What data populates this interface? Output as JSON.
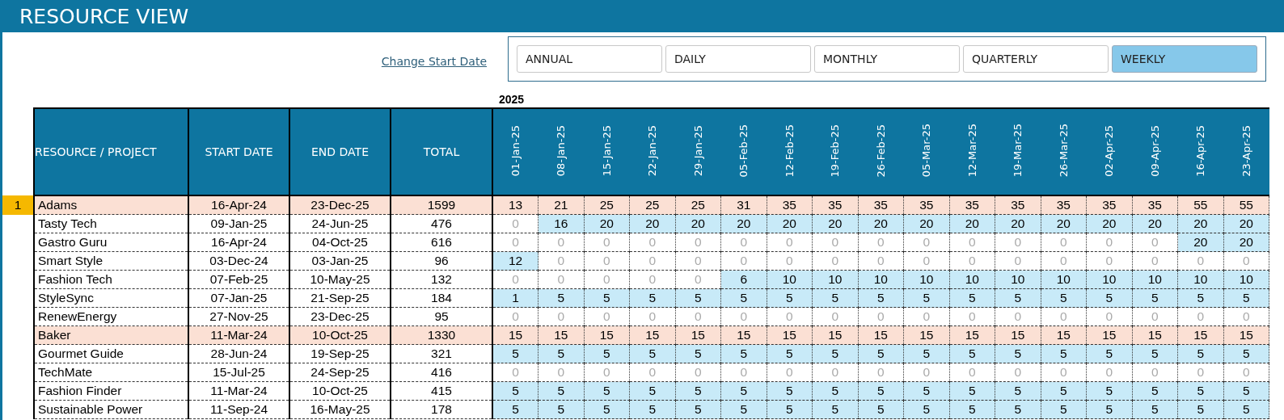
{
  "title": "RESOURCE VIEW",
  "change_start_date": "Change Start Date",
  "periods": [
    {
      "label": "ANNUAL",
      "selected": false
    },
    {
      "label": "DAILY",
      "selected": false
    },
    {
      "label": "MONTHLY",
      "selected": false
    },
    {
      "label": "QUARTERLY",
      "selected": false
    },
    {
      "label": "WEEKLY",
      "selected": true
    }
  ],
  "year": "2025",
  "table": {
    "columns": [
      "RESOURCE / PROJECT",
      "START DATE",
      "END DATE",
      "TOTAL"
    ],
    "weeks": [
      "01-Jan-25",
      "08-Jan-25",
      "15-Jan-25",
      "22-Jan-25",
      "29-Jan-25",
      "05-Feb-25",
      "12-Feb-25",
      "19-Feb-25",
      "26-Feb-25",
      "05-Mar-25",
      "12-Mar-25",
      "19-Mar-25",
      "26-Mar-25",
      "02-Apr-25",
      "09-Apr-25",
      "16-Apr-25",
      "23-Apr-25"
    ],
    "rows": [
      {
        "kind": "resource",
        "row_number": "1",
        "name": "Adams",
        "start": "16-Apr-24",
        "end": "23-Dec-25",
        "total": "1599",
        "values": [
          "13",
          "21",
          "25",
          "25",
          "25",
          "31",
          "35",
          "35",
          "35",
          "35",
          "35",
          "35",
          "35",
          "35",
          "35",
          "55",
          "55"
        ]
      },
      {
        "kind": "project",
        "name": "Tasty Tech",
        "start": "09-Jan-25",
        "end": "24-Jun-25",
        "total": "476",
        "cells": [
          {
            "value": "0",
            "active": false
          },
          {
            "value": "16",
            "active": true
          },
          {
            "value": "20",
            "active": true
          },
          {
            "value": "20",
            "active": true
          },
          {
            "value": "20",
            "active": true
          },
          {
            "value": "20",
            "active": true
          },
          {
            "value": "20",
            "active": true
          },
          {
            "value": "20",
            "active": true
          },
          {
            "value": "20",
            "active": true
          },
          {
            "value": "20",
            "active": true
          },
          {
            "value": "20",
            "active": true
          },
          {
            "value": "20",
            "active": true
          },
          {
            "value": "20",
            "active": true
          },
          {
            "value": "20",
            "active": true
          },
          {
            "value": "20",
            "active": true
          },
          {
            "value": "20",
            "active": true
          },
          {
            "value": "20",
            "active": true
          }
        ]
      },
      {
        "kind": "project",
        "name": "Gastro Guru",
        "start": "16-Apr-24",
        "end": "04-Oct-25",
        "total": "616",
        "cells": [
          {
            "value": "0",
            "active": false
          },
          {
            "value": "0",
            "active": false
          },
          {
            "value": "0",
            "active": false
          },
          {
            "value": "0",
            "active": false
          },
          {
            "value": "0",
            "active": false
          },
          {
            "value": "0",
            "active": false
          },
          {
            "value": "0",
            "active": false
          },
          {
            "value": "0",
            "active": false
          },
          {
            "value": "0",
            "active": false
          },
          {
            "value": "0",
            "active": false
          },
          {
            "value": "0",
            "active": false
          },
          {
            "value": "0",
            "active": false
          },
          {
            "value": "0",
            "active": false
          },
          {
            "value": "0",
            "active": false
          },
          {
            "value": "0",
            "active": false
          },
          {
            "value": "20",
            "active": true
          },
          {
            "value": "20",
            "active": true
          }
        ]
      },
      {
        "kind": "project",
        "name": "Smart Style",
        "start": "03-Dec-24",
        "end": "03-Jan-25",
        "total": "96",
        "cells": [
          {
            "value": "12",
            "active": true
          },
          {
            "value": "0",
            "active": false
          },
          {
            "value": "0",
            "active": false
          },
          {
            "value": "0",
            "active": false
          },
          {
            "value": "0",
            "active": false
          },
          {
            "value": "0",
            "active": false
          },
          {
            "value": "0",
            "active": false
          },
          {
            "value": "0",
            "active": false
          },
          {
            "value": "0",
            "active": false
          },
          {
            "value": "0",
            "active": false
          },
          {
            "value": "0",
            "active": false
          },
          {
            "value": "0",
            "active": false
          },
          {
            "value": "0",
            "active": false
          },
          {
            "value": "0",
            "active": false
          },
          {
            "value": "0",
            "active": false
          },
          {
            "value": "0",
            "active": false
          },
          {
            "value": "0",
            "active": false
          }
        ]
      },
      {
        "kind": "project",
        "name": "Fashion Tech",
        "start": "07-Feb-25",
        "end": "10-May-25",
        "total": "132",
        "cells": [
          {
            "value": "0",
            "active": false
          },
          {
            "value": "0",
            "active": false
          },
          {
            "value": "0",
            "active": false
          },
          {
            "value": "0",
            "active": false
          },
          {
            "value": "0",
            "active": false
          },
          {
            "value": "6",
            "active": true
          },
          {
            "value": "10",
            "active": true
          },
          {
            "value": "10",
            "active": true
          },
          {
            "value": "10",
            "active": true
          },
          {
            "value": "10",
            "active": true
          },
          {
            "value": "10",
            "active": true
          },
          {
            "value": "10",
            "active": true
          },
          {
            "value": "10",
            "active": true
          },
          {
            "value": "10",
            "active": true
          },
          {
            "value": "10",
            "active": true
          },
          {
            "value": "10",
            "active": true
          },
          {
            "value": "10",
            "active": true
          }
        ]
      },
      {
        "kind": "project",
        "name": "StyleSync",
        "start": "07-Jan-25",
        "end": "21-Sep-25",
        "total": "184",
        "cells": [
          {
            "value": "1",
            "active": true
          },
          {
            "value": "5",
            "active": true
          },
          {
            "value": "5",
            "active": true
          },
          {
            "value": "5",
            "active": true
          },
          {
            "value": "5",
            "active": true
          },
          {
            "value": "5",
            "active": true
          },
          {
            "value": "5",
            "active": true
          },
          {
            "value": "5",
            "active": true
          },
          {
            "value": "5",
            "active": true
          },
          {
            "value": "5",
            "active": true
          },
          {
            "value": "5",
            "active": true
          },
          {
            "value": "5",
            "active": true
          },
          {
            "value": "5",
            "active": true
          },
          {
            "value": "5",
            "active": true
          },
          {
            "value": "5",
            "active": true
          },
          {
            "value": "5",
            "active": true
          },
          {
            "value": "5",
            "active": true
          }
        ]
      },
      {
        "kind": "project",
        "name": "RenewEnergy",
        "start": "27-Nov-25",
        "end": "23-Dec-25",
        "total": "95",
        "cells": [
          {
            "value": "0",
            "active": false
          },
          {
            "value": "0",
            "active": false
          },
          {
            "value": "0",
            "active": false
          },
          {
            "value": "0",
            "active": false
          },
          {
            "value": "0",
            "active": false
          },
          {
            "value": "0",
            "active": false
          },
          {
            "value": "0",
            "active": false
          },
          {
            "value": "0",
            "active": false
          },
          {
            "value": "0",
            "active": false
          },
          {
            "value": "0",
            "active": false
          },
          {
            "value": "0",
            "active": false
          },
          {
            "value": "0",
            "active": false
          },
          {
            "value": "0",
            "active": false
          },
          {
            "value": "0",
            "active": false
          },
          {
            "value": "0",
            "active": false
          },
          {
            "value": "0",
            "active": false
          },
          {
            "value": "0",
            "active": false
          }
        ]
      },
      {
        "kind": "resource",
        "name": "Baker",
        "start": "11-Mar-24",
        "end": "10-Oct-25",
        "total": "1330",
        "values": [
          "15",
          "15",
          "15",
          "15",
          "15",
          "15",
          "15",
          "15",
          "15",
          "15",
          "15",
          "15",
          "15",
          "15",
          "15",
          "15",
          "15"
        ]
      },
      {
        "kind": "project",
        "name": "Gourmet Guide",
        "start": "28-Jun-24",
        "end": "19-Sep-25",
        "total": "321",
        "cells": [
          {
            "value": "5",
            "active": true
          },
          {
            "value": "5",
            "active": true
          },
          {
            "value": "5",
            "active": true
          },
          {
            "value": "5",
            "active": true
          },
          {
            "value": "5",
            "active": true
          },
          {
            "value": "5",
            "active": true
          },
          {
            "value": "5",
            "active": true
          },
          {
            "value": "5",
            "active": true
          },
          {
            "value": "5",
            "active": true
          },
          {
            "value": "5",
            "active": true
          },
          {
            "value": "5",
            "active": true
          },
          {
            "value": "5",
            "active": true
          },
          {
            "value": "5",
            "active": true
          },
          {
            "value": "5",
            "active": true
          },
          {
            "value": "5",
            "active": true
          },
          {
            "value": "5",
            "active": true
          },
          {
            "value": "5",
            "active": true
          }
        ]
      },
      {
        "kind": "project",
        "name": "TechMate",
        "start": "15-Jul-25",
        "end": "24-Sep-25",
        "total": "416",
        "cells": [
          {
            "value": "0",
            "active": false
          },
          {
            "value": "0",
            "active": false
          },
          {
            "value": "0",
            "active": false
          },
          {
            "value": "0",
            "active": false
          },
          {
            "value": "0",
            "active": false
          },
          {
            "value": "0",
            "active": false
          },
          {
            "value": "0",
            "active": false
          },
          {
            "value": "0",
            "active": false
          },
          {
            "value": "0",
            "active": false
          },
          {
            "value": "0",
            "active": false
          },
          {
            "value": "0",
            "active": false
          },
          {
            "value": "0",
            "active": false
          },
          {
            "value": "0",
            "active": false
          },
          {
            "value": "0",
            "active": false
          },
          {
            "value": "0",
            "active": false
          },
          {
            "value": "0",
            "active": false
          },
          {
            "value": "0",
            "active": false
          }
        ]
      },
      {
        "kind": "project",
        "name": "Fashion Finder",
        "start": "11-Mar-24",
        "end": "10-Oct-25",
        "total": "415",
        "cells": [
          {
            "value": "5",
            "active": true
          },
          {
            "value": "5",
            "active": true
          },
          {
            "value": "5",
            "active": true
          },
          {
            "value": "5",
            "active": true
          },
          {
            "value": "5",
            "active": true
          },
          {
            "value": "5",
            "active": true
          },
          {
            "value": "5",
            "active": true
          },
          {
            "value": "5",
            "active": true
          },
          {
            "value": "5",
            "active": true
          },
          {
            "value": "5",
            "active": true
          },
          {
            "value": "5",
            "active": true
          },
          {
            "value": "5",
            "active": true
          },
          {
            "value": "5",
            "active": true
          },
          {
            "value": "5",
            "active": true
          },
          {
            "value": "5",
            "active": true
          },
          {
            "value": "5",
            "active": true
          },
          {
            "value": "5",
            "active": true
          }
        ]
      },
      {
        "kind": "project",
        "name": "Sustainable Power",
        "start": "11-Sep-24",
        "end": "16-May-25",
        "total": "178",
        "cells": [
          {
            "value": "5",
            "active": true
          },
          {
            "value": "5",
            "active": true
          },
          {
            "value": "5",
            "active": true
          },
          {
            "value": "5",
            "active": true
          },
          {
            "value": "5",
            "active": true
          },
          {
            "value": "5",
            "active": true
          },
          {
            "value": "5",
            "active": true
          },
          {
            "value": "5",
            "active": true
          },
          {
            "value": "5",
            "active": true
          },
          {
            "value": "5",
            "active": true
          },
          {
            "value": "5",
            "active": true
          },
          {
            "value": "5",
            "active": true
          },
          {
            "value": "5",
            "active": true
          },
          {
            "value": "5",
            "active": true
          },
          {
            "value": "5",
            "active": true
          },
          {
            "value": "5",
            "active": true
          },
          {
            "value": "5",
            "active": true
          }
        ]
      }
    ]
  }
}
